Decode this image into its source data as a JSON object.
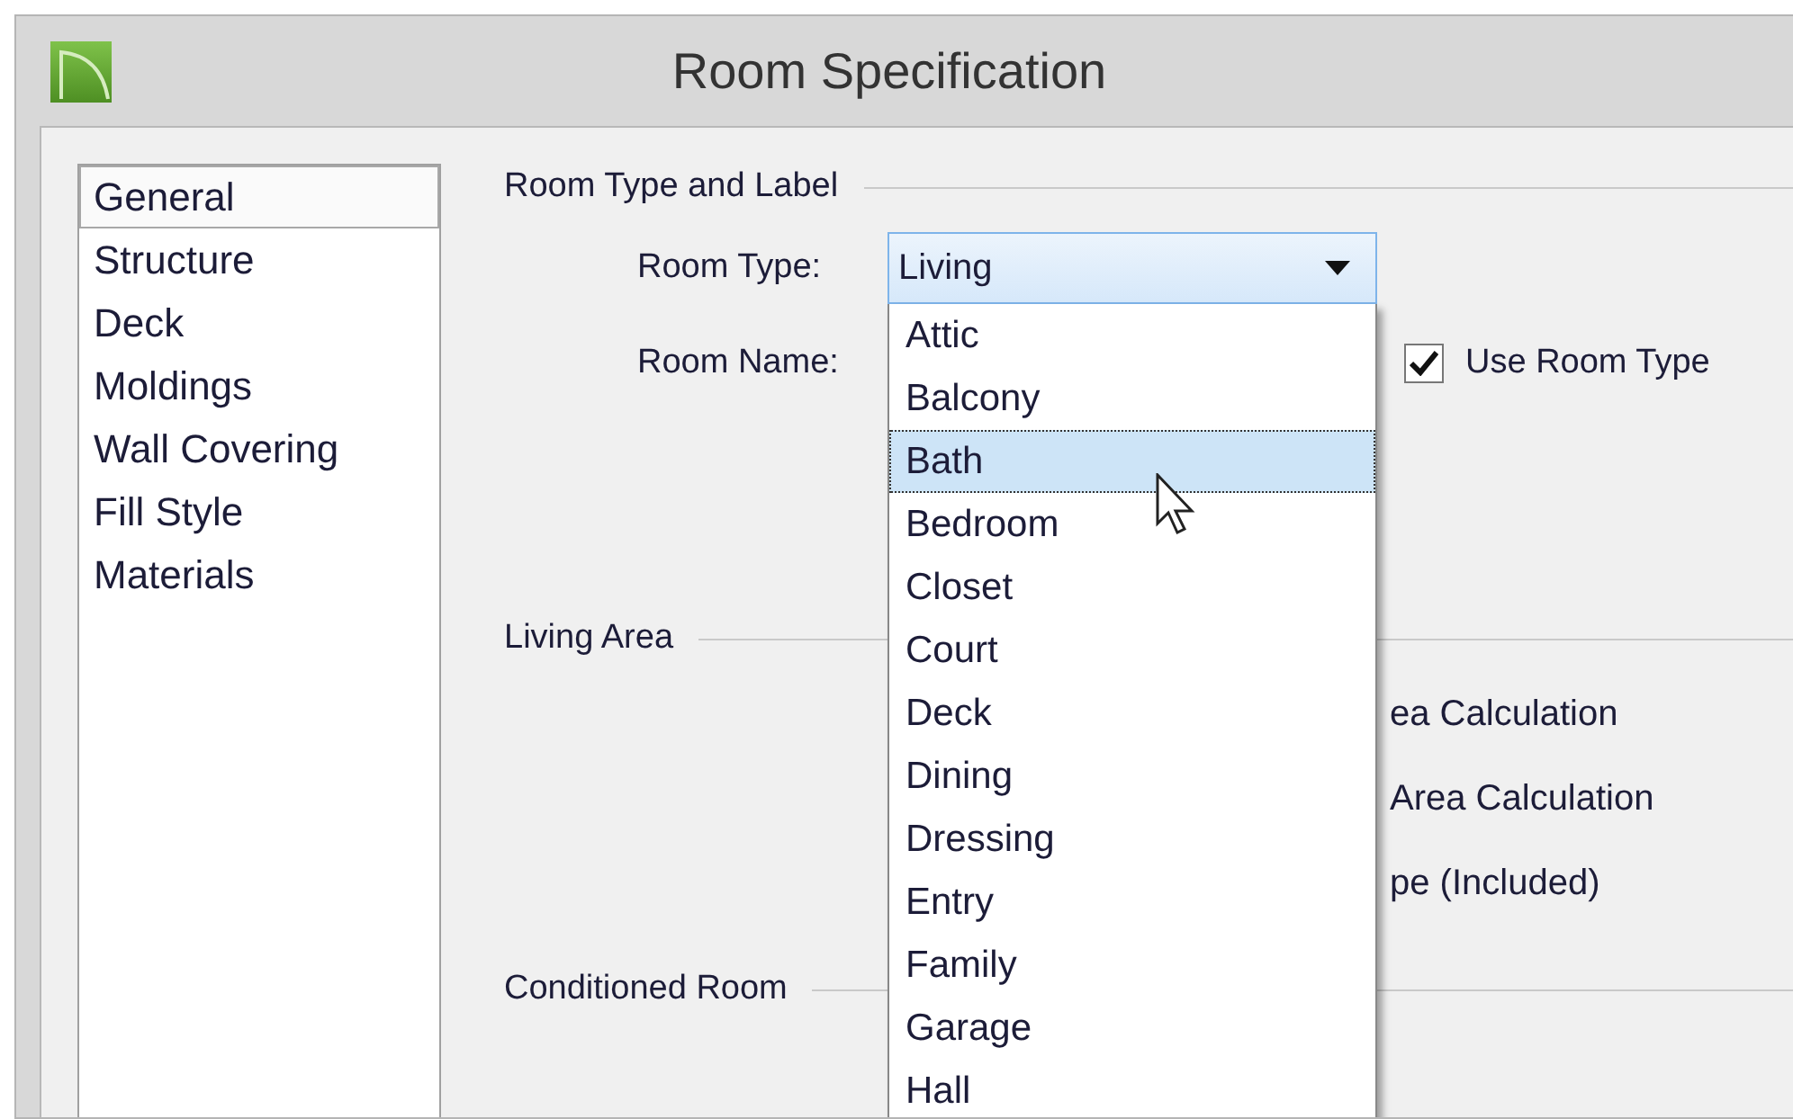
{
  "window": {
    "title": "Room Specification"
  },
  "sidebar": {
    "items": [
      {
        "label": "General",
        "selected": true
      },
      {
        "label": "Structure",
        "selected": false
      },
      {
        "label": "Deck",
        "selected": false
      },
      {
        "label": "Moldings",
        "selected": false
      },
      {
        "label": "Wall Covering",
        "selected": false
      },
      {
        "label": "Fill Style",
        "selected": false
      },
      {
        "label": "Materials",
        "selected": false
      }
    ]
  },
  "room_type_and_label": {
    "title": "Room Type and Label",
    "room_type": {
      "label": "Room Type:",
      "value": "Living",
      "expanded": true,
      "options": [
        {
          "label": "Attic",
          "selected": false
        },
        {
          "label": "Balcony",
          "selected": false
        },
        {
          "label": "Bath",
          "selected": true
        },
        {
          "label": "Bedroom",
          "selected": false
        },
        {
          "label": "Closet",
          "selected": false
        },
        {
          "label": "Court",
          "selected": false
        },
        {
          "label": "Deck",
          "selected": false
        },
        {
          "label": "Dining",
          "selected": false
        },
        {
          "label": "Dressing",
          "selected": false
        },
        {
          "label": "Entry",
          "selected": false
        },
        {
          "label": "Family",
          "selected": false
        },
        {
          "label": "Garage",
          "selected": false
        },
        {
          "label": "Hall",
          "selected": false
        }
      ]
    },
    "room_name": {
      "label": "Room Name:"
    },
    "use_room_type": {
      "label": "Use Room Type",
      "checked": true
    }
  },
  "living_area": {
    "title": "Living Area",
    "options": [
      {
        "label": "ea Calculation"
      },
      {
        "label": "Area Calculation"
      },
      {
        "label": "pe (Included)"
      }
    ]
  },
  "conditioned_room": {
    "title": "Conditioned Room"
  }
}
